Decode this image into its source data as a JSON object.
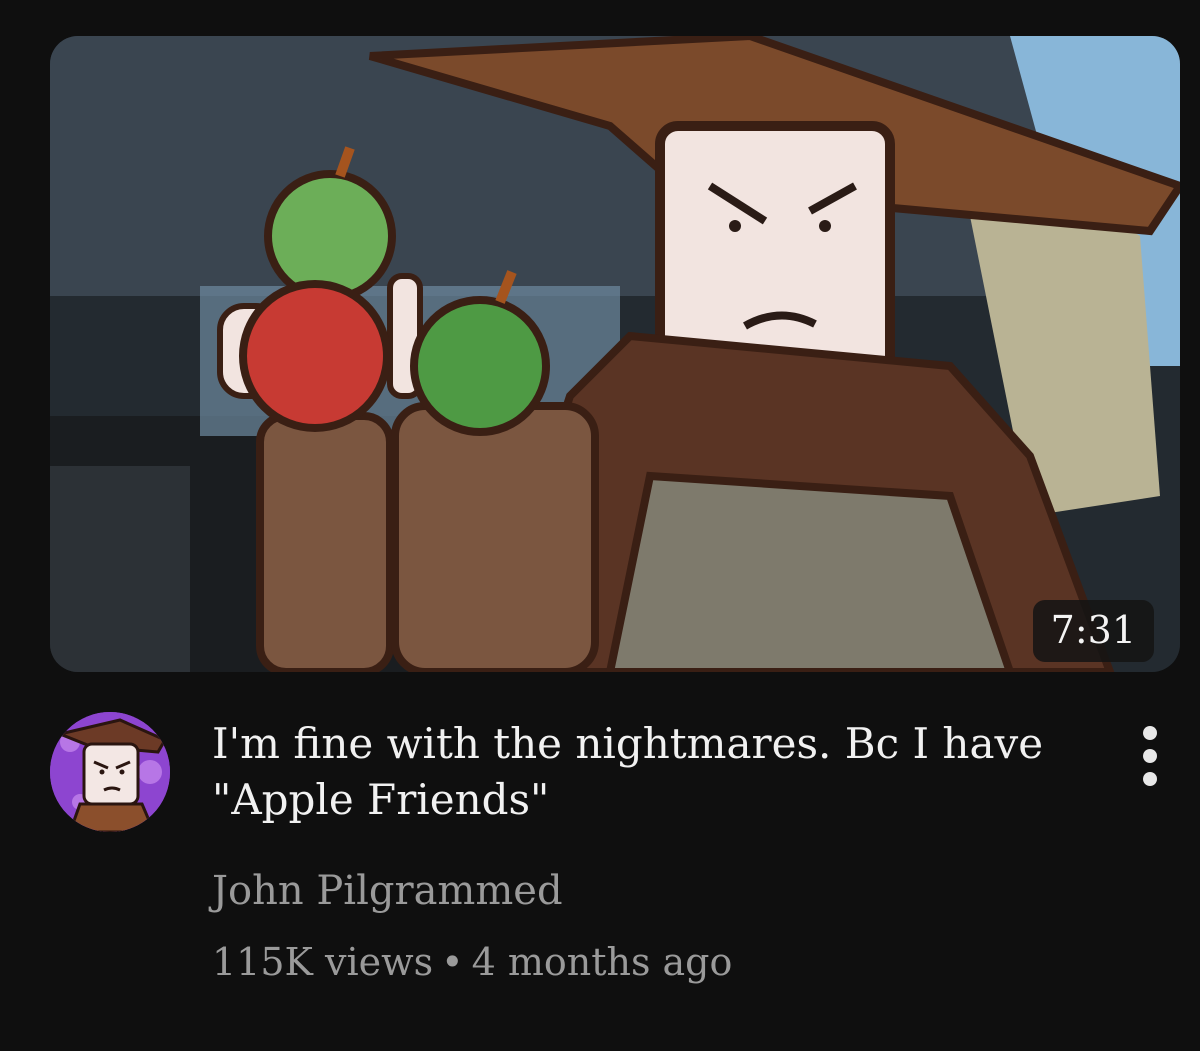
{
  "video": {
    "duration": "7:31",
    "title": "I'm fine with the nightmares. Bc I have \"Apple Friends\"",
    "channel": "John Pilgrammed",
    "views": "115K views",
    "separator": "•",
    "age": "4 months ago"
  },
  "icons": {
    "more": "more-vert-icon",
    "avatar": "channel-avatar"
  }
}
